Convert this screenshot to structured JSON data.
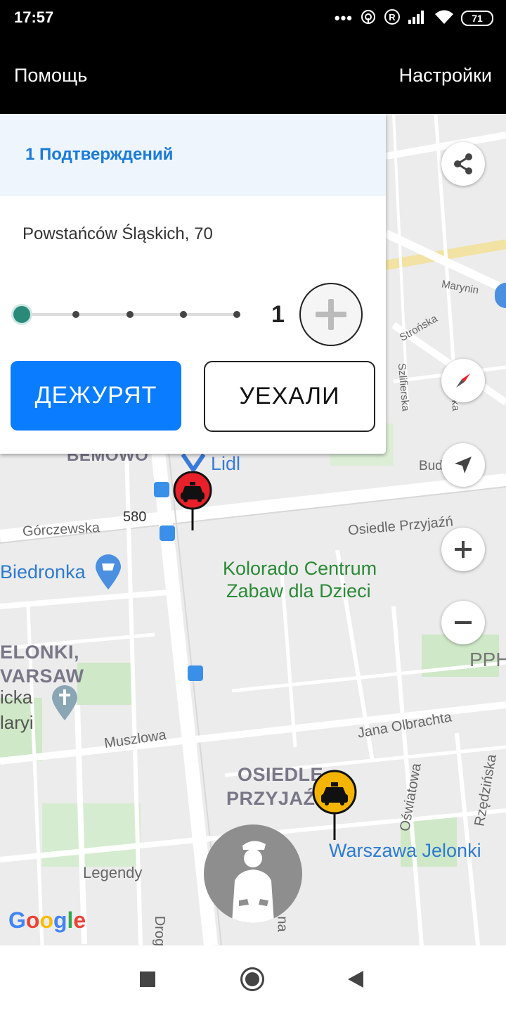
{
  "status_bar": {
    "time": "17:57",
    "battery": "71",
    "icons": [
      "more-icon",
      "hotspot-icon",
      "registered-icon",
      "signal-icon",
      "wifi-icon",
      "battery-icon"
    ]
  },
  "app_bar": {
    "help_label": "Помощь",
    "settings_label": "Настройки"
  },
  "card": {
    "header": "1 Подтверждений",
    "address": "Powstańców Śląskich, 70",
    "stepper": {
      "steps": 5,
      "active": 1
    },
    "count": "1",
    "primary_button": "ДЕЖУРЯТ",
    "secondary_button": "УЕХАЛИ"
  },
  "map": {
    "labels": {
      "bemowo": "BEMOWO",
      "lidl": "Lidl",
      "road_580": "580",
      "gorczewska": "Górczewska",
      "osiedle_przyjazn": "Osiedle Przyjaźń",
      "biedronka": "Biedronka",
      "kolorado_1": "Kolorado Centrum",
      "kolorado_2": "Zabaw dla Dzieci",
      "jelonki_1": "ELONKI,",
      "jelonki_2": "VARSAW",
      "icka": "icka",
      "aryi": "laryi",
      "muszlowa": "Muszlowa",
      "jana_olbrachta": "Jana Olbrachta",
      "osiedle_big_1": "OSIEDLE",
      "osiedle_big_2": "PRZYJAŹ",
      "oswiatowa": "Oświatowa",
      "rzedzinska": "Rzędzińska",
      "warszawa_jelonki": "Warszawa Jelonki",
      "legendy": "Legendy",
      "drog": "Drog",
      "na": "na",
      "marynin": "Marynin",
      "strzelinska": "Strońska",
      "szlifierska": "Szlifierska",
      "budx": "Bud",
      "pph": "PPH",
      "ska": "ska"
    },
    "google_logo": "Google"
  },
  "colors": {
    "primary": "#0a7cff",
    "header_bg": "#eef5fc",
    "header_text": "#1a7bd8",
    "stepper_active": "#2a8a7a",
    "taxi_red": "#e8202a",
    "taxi_yellow": "#f5b400"
  },
  "controls": [
    "share-icon",
    "compass-icon",
    "my-location-icon",
    "zoom-in-icon",
    "zoom-out-icon"
  ]
}
